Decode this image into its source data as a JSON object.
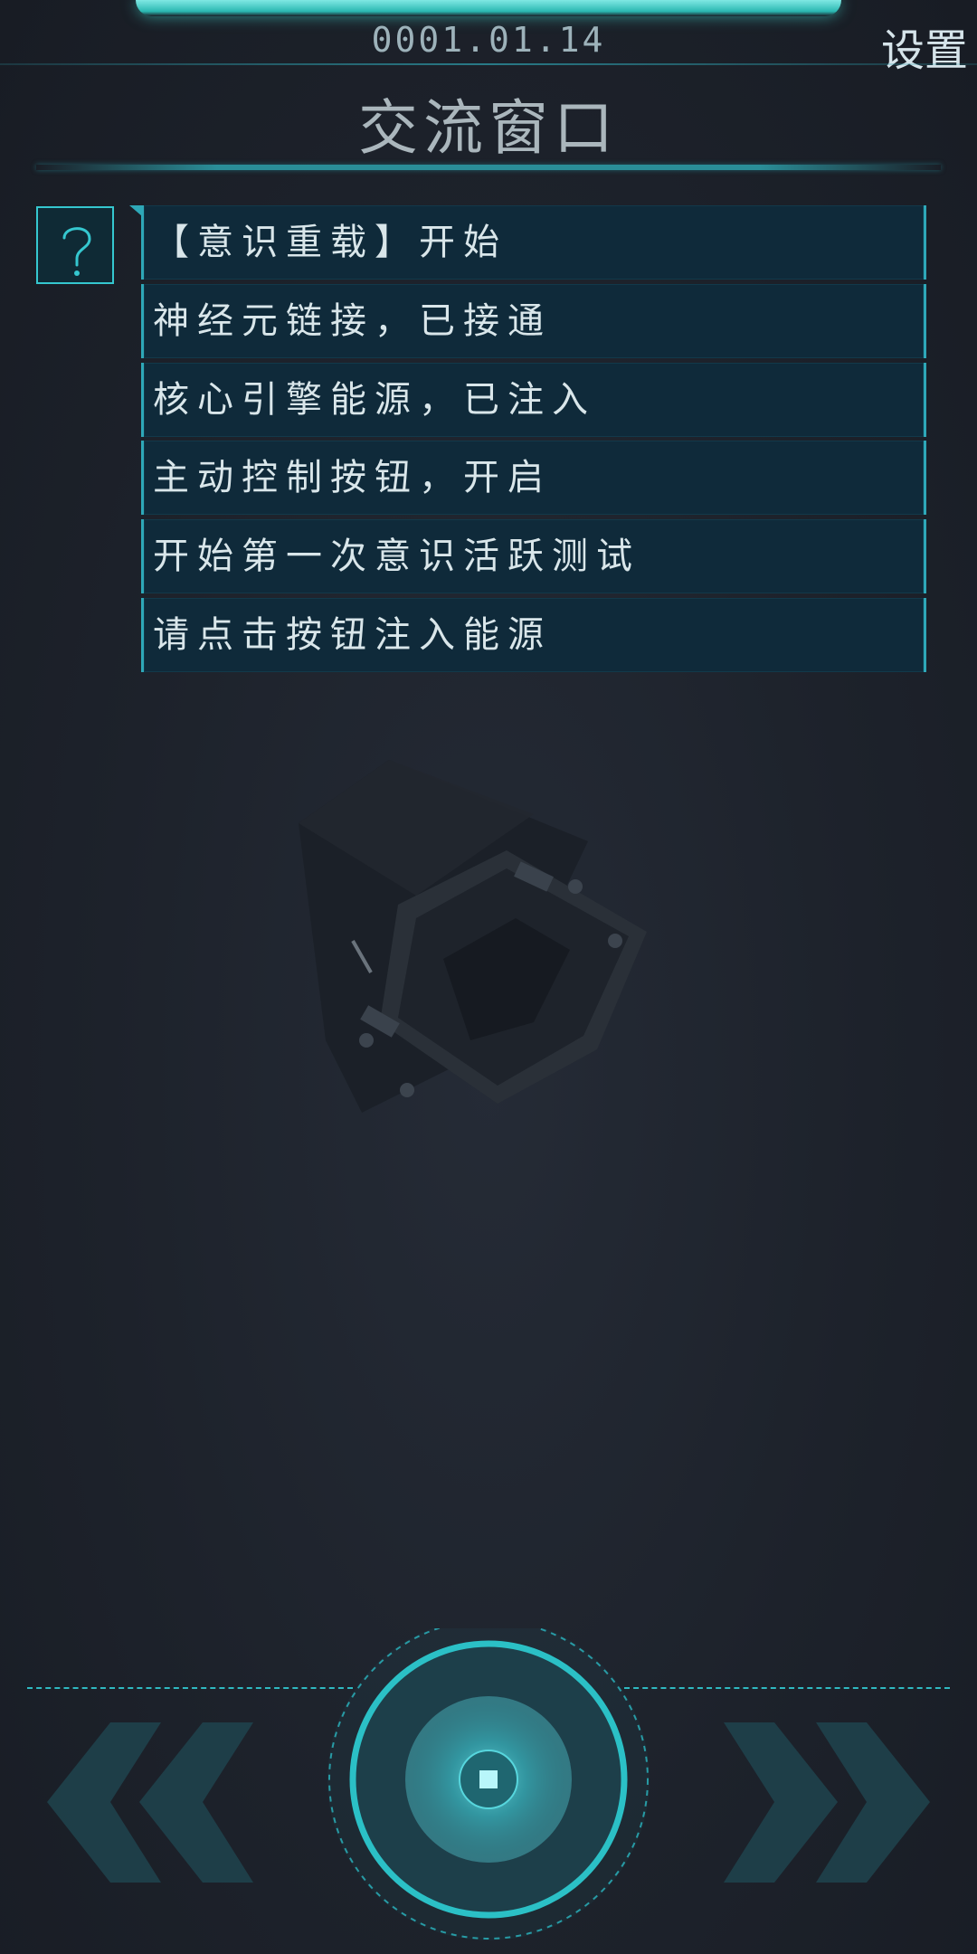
{
  "header": {
    "date": "0001.01.14",
    "settings_label": "设置",
    "title": "交流窗口"
  },
  "messages": [
    "【意识重载】开始",
    "神经元链接，已接通",
    "核心引擎能源，已注入",
    "主动控制按钮，开启",
    "开始第一次意识活跃测试",
    "请点击按钮注入能源"
  ],
  "icons": {
    "help": "question-icon",
    "prev": "double-chevron-left-icon",
    "next": "double-chevron-right-icon",
    "center": "energy-core-button"
  },
  "colors": {
    "accent": "#35c7cf",
    "panel": "#0f2a3a",
    "background": "#1d222b"
  }
}
